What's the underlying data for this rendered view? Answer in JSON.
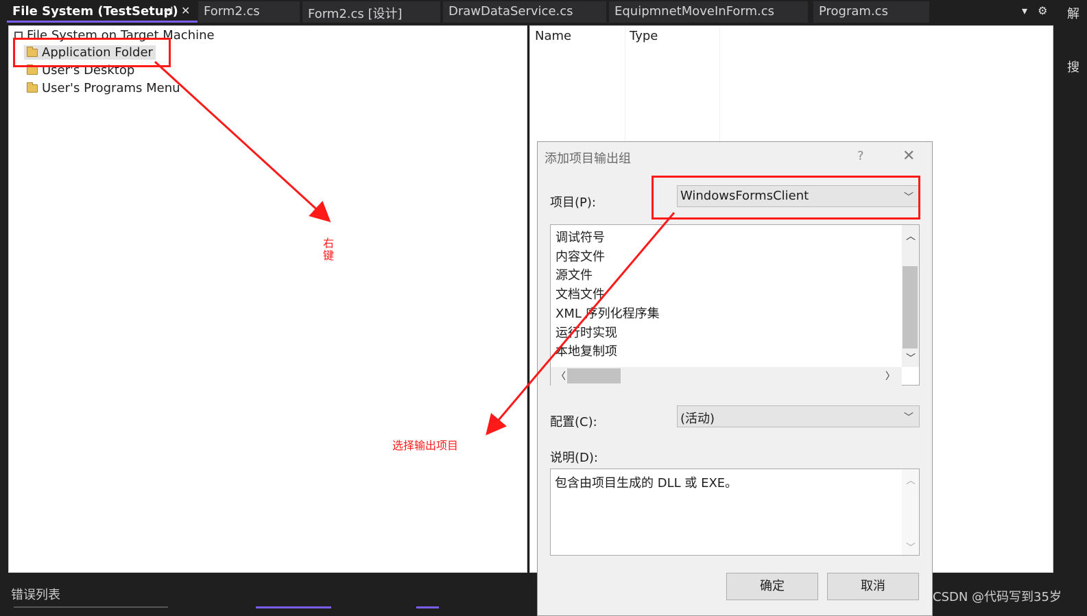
{
  "tabs": [
    {
      "label": "File System (TestSetup)",
      "active": true
    },
    {
      "label": "Form2.cs"
    },
    {
      "label": "Form2.cs [设计]"
    },
    {
      "label": "DrawDataService.cs"
    },
    {
      "label": "EquipmnetMoveInForm.cs"
    },
    {
      "label": "Program.cs"
    }
  ],
  "tab_icons": {
    "pin": "⊣",
    "close": "✕",
    "dropdown": "▾",
    "settings": "⚙"
  },
  "right_sidebar": {
    "chars": [
      "解",
      "搜"
    ]
  },
  "tree": {
    "root": "File System on Target Machine",
    "items": [
      "Application Folder",
      "User's Desktop",
      "User's Programs Menu"
    ]
  },
  "file_list": {
    "columns": [
      "Name",
      "Type"
    ]
  },
  "dialog": {
    "title": "添加项目输出组",
    "help": "?",
    "close": "✕",
    "project_label": "项目(P):",
    "project_value": "WindowsFormsClient",
    "outputs": [
      "调试符号",
      "内容文件",
      "源文件",
      "文档文件",
      "XML 序列化程序集",
      "运行时实现",
      "本地复制项"
    ],
    "config_label": "配置(C):",
    "config_value": "(活动)",
    "desc_label": "说明(D):",
    "desc_text": "包含由项目生成的 DLL 或 EXE。",
    "ok": "确定",
    "cancel": "取消"
  },
  "bottom": {
    "errors_label": "错误列表",
    "watermark": "CSDN @代码写到35岁"
  },
  "annotations": {
    "right_click": "右\n键",
    "select_output": "选择输出项目",
    "color": "#ff1a1a"
  }
}
